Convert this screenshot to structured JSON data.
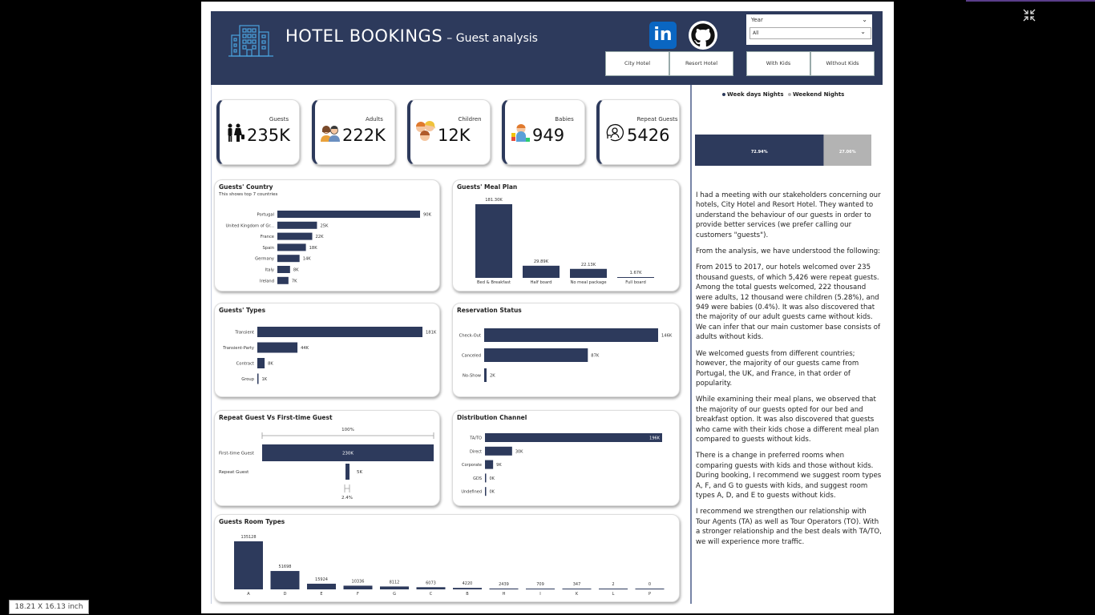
{
  "header": {
    "title": "HOTEL BOOKINGS",
    "subtitle": "– Guest analysis",
    "linkedin_label": "in",
    "year_slicer": {
      "label": "Year",
      "selected": "All"
    },
    "hotel_buttons": [
      "City Hotel",
      "Resort Hotel"
    ],
    "kids_buttons": [
      "With Kids",
      "Without Kids"
    ]
  },
  "kpis": [
    {
      "label": "Guests",
      "value": "235K",
      "icon": "family-icon"
    },
    {
      "label": "Adults",
      "value": "222K",
      "icon": "adults-icon"
    },
    {
      "label": "Children",
      "value": "12K",
      "icon": "children-icon"
    },
    {
      "label": "Babies",
      "value": "949",
      "icon": "baby-icon"
    },
    {
      "label": "Repeat Guests",
      "value": "5426",
      "icon": "repeat-guest-icon"
    }
  ],
  "colors": {
    "navy": "#2d3a5c",
    "gray": "#b3b3b3"
  },
  "chart_data": [
    {
      "id": "country",
      "type": "bar",
      "orientation": "horizontal",
      "title": "Guests' Country",
      "subtitle": "This shows top 7 countries",
      "categories": [
        "Portugal",
        "United Kingdom of Gr...",
        "France",
        "Spain",
        "Germany",
        "Italy",
        "Ireland"
      ],
      "values": [
        90,
        25,
        22,
        18,
        14,
        8,
        7
      ],
      "labels": [
        "90K",
        "25K",
        "22K",
        "18K",
        "14K",
        "8K",
        "7K"
      ]
    },
    {
      "id": "meal",
      "type": "bar",
      "title": "Guests' Meal Plan",
      "categories": [
        "Bed & Breakfast",
        "Half board",
        "No meal package",
        "Full board"
      ],
      "values": [
        181300,
        29890,
        22130,
        1670
      ],
      "labels": [
        "181.30K",
        "29.89K",
        "22.13K",
        "1.67K"
      ]
    },
    {
      "id": "types",
      "type": "bar",
      "orientation": "horizontal",
      "title": "Guests' Types",
      "categories": [
        "Transient",
        "Transient-Party",
        "Contract",
        "Group"
      ],
      "values": [
        181,
        44,
        8,
        1
      ],
      "labels": [
        "181K",
        "44K",
        "8K",
        "1K"
      ]
    },
    {
      "id": "reservation",
      "type": "bar",
      "orientation": "horizontal",
      "title": "Reservation Status",
      "categories": [
        "Check-Out",
        "Canceled",
        "No-Show"
      ],
      "values": [
        146,
        87,
        2
      ],
      "labels": [
        "146K",
        "87K",
        "2K"
      ]
    },
    {
      "id": "repeat",
      "type": "bar",
      "orientation": "horizontal",
      "title": "Repeat Guest Vs First-time Guest",
      "categories": [
        "First-time Guest",
        "Repeat Guest"
      ],
      "values": [
        230,
        5
      ],
      "labels": [
        "230K",
        "5K"
      ],
      "top_percent": "100%",
      "bottom_percent": "2.4%"
    },
    {
      "id": "distribution",
      "type": "bar",
      "orientation": "horizontal",
      "title": "Distribution Channel",
      "categories": [
        "TA/TO",
        "Direct",
        "Corporate",
        "GDS",
        "Undefined"
      ],
      "values": [
        196,
        30,
        9,
        0.2,
        0.1
      ],
      "labels": [
        "196K",
        "30K",
        "9K",
        "0K",
        "0K"
      ]
    },
    {
      "id": "rooms",
      "type": "bar",
      "title": "Guests Room Types",
      "categories": [
        "A",
        "D",
        "E",
        "F",
        "G",
        "C",
        "B",
        "H",
        "I",
        "K",
        "L",
        "P"
      ],
      "values": [
        135128,
        51698,
        15924,
        10336,
        8112,
        6073,
        4220,
        2439,
        709,
        347,
        2,
        0
      ]
    },
    {
      "id": "nights",
      "type": "bar",
      "orientation": "horizontal",
      "stacked": true,
      "series": [
        {
          "name": "Week days Nights",
          "values": [
            72.94
          ],
          "label": "72.94%"
        },
        {
          "name": "Weekend Nights",
          "values": [
            27.06
          ],
          "label": "27.06%"
        }
      ]
    }
  ],
  "story": [
    "I had a meeting with our stakeholders concerning our hotels, City Hotel and Resort Hotel. They wanted to understand the behaviour of our guests in order to provide better services (we prefer calling our customers \"guests\").",
    "From the analysis, we have understood the following:",
    "From 2015 to 2017, our hotels welcomed over 235 thousand guests, of which 5,426 were repeat guests. Among the total guests welcomed, 222 thousand were adults, 12 thousand were children (5.28%), and 949 were babies (0.4%). It was also discovered that the majority of our adult guests came without kids. We can infer that our main customer base consists of adults without kids.",
    "We welcomed guests from different countries; however, the majority of our guests came from Portugal, the UK, and France, in that order of popularity.",
    "While examining their meal plans, we observed that the majority of our guests opted for our bed and breakfast option. It was also discovered that guests who came with their kids chose a different meal plan compared to guests without kids.",
    "There is a change in preferred rooms when comparing guests with kids and those without kids. During booking, I recommend we suggest room types A, F, and G to guests with kids, and suggest room types A, D, and E to guests without kids.",
    "I recommend we strengthen our relationship with Tour Agents (TA) as well as Tour Operators (TO). With a stronger relationship and the best deals with TA/TO, we will experience more traffic."
  ],
  "status_bar": "18.21 X 16.13 inch"
}
